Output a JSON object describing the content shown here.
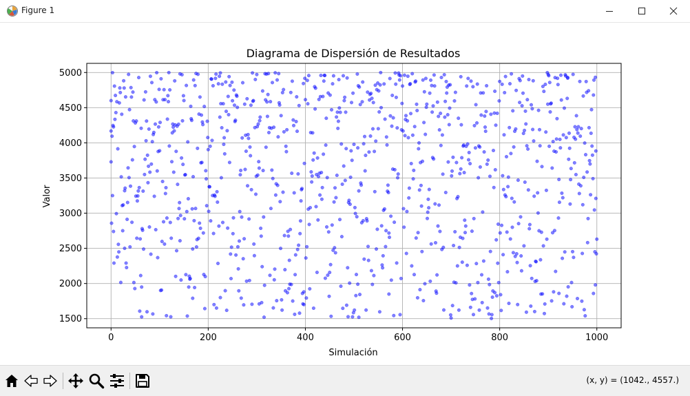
{
  "window": {
    "title": "Figure 1"
  },
  "toolbar": {
    "buttons": [
      {
        "name": "home-icon"
      },
      {
        "name": "back-icon"
      },
      {
        "name": "forward-icon"
      },
      {
        "name": "pan-icon"
      },
      {
        "name": "zoom-icon"
      },
      {
        "name": "configure-subplots-icon"
      },
      {
        "name": "save-icon"
      }
    ],
    "coords": "(x, y) = (1042., 4557.)"
  },
  "chart_data": {
    "type": "scatter",
    "title": "Diagrama de Dispersión de Resultados",
    "xlabel": "Simulación",
    "ylabel": "Valor",
    "xlim": [
      -50,
      1050
    ],
    "ylim": [
      1370,
      5130
    ],
    "xticks": [
      0,
      200,
      400,
      600,
      800,
      1000
    ],
    "yticks": [
      1500,
      2000,
      2500,
      3000,
      3500,
      4000,
      4500,
      5000
    ],
    "xtick_labels": [
      "0",
      "200",
      "400",
      "600",
      "800",
      "1000"
    ],
    "ytick_labels": [
      "1500",
      "2000",
      "2500",
      "3000",
      "3500",
      "4000",
      "4500",
      "5000"
    ],
    "grid": true,
    "marker_color": "#0000ff",
    "marker_alpha": 0.5,
    "n_points": 1000,
    "value_range": [
      1500,
      5000
    ],
    "sample_points": [
      {
        "x": 0,
        "y": 3730
      },
      {
        "x": 0,
        "y": 4600
      },
      {
        "x": 3,
        "y": 3250
      },
      {
        "x": 5,
        "y": 2740
      },
      {
        "x": 28,
        "y": 2500
      },
      {
        "x": 63,
        "y": 1950
      },
      {
        "x": 142,
        "y": 4980
      },
      {
        "x": 168,
        "y": 1790
      },
      {
        "x": 225,
        "y": 1800
      },
      {
        "x": 305,
        "y": 1710
      },
      {
        "x": 397,
        "y": 1700
      },
      {
        "x": 510,
        "y": 1520
      },
      {
        "x": 508,
        "y": 1990
      },
      {
        "x": 572,
        "y": 1850
      },
      {
        "x": 720,
        "y": 4940
      },
      {
        "x": 790,
        "y": 1870
      },
      {
        "x": 922,
        "y": 1860
      },
      {
        "x": 940,
        "y": 4930
      },
      {
        "x": 993,
        "y": 4680
      },
      {
        "x": 998,
        "y": 3210
      },
      {
        "x": 1000,
        "y": 2630
      },
      {
        "x": 997,
        "y": 1980
      }
    ]
  },
  "colors": {
    "grid": "#b0b0b0",
    "axes": "#000000",
    "toolbar_bg": "#f0f0f0"
  }
}
